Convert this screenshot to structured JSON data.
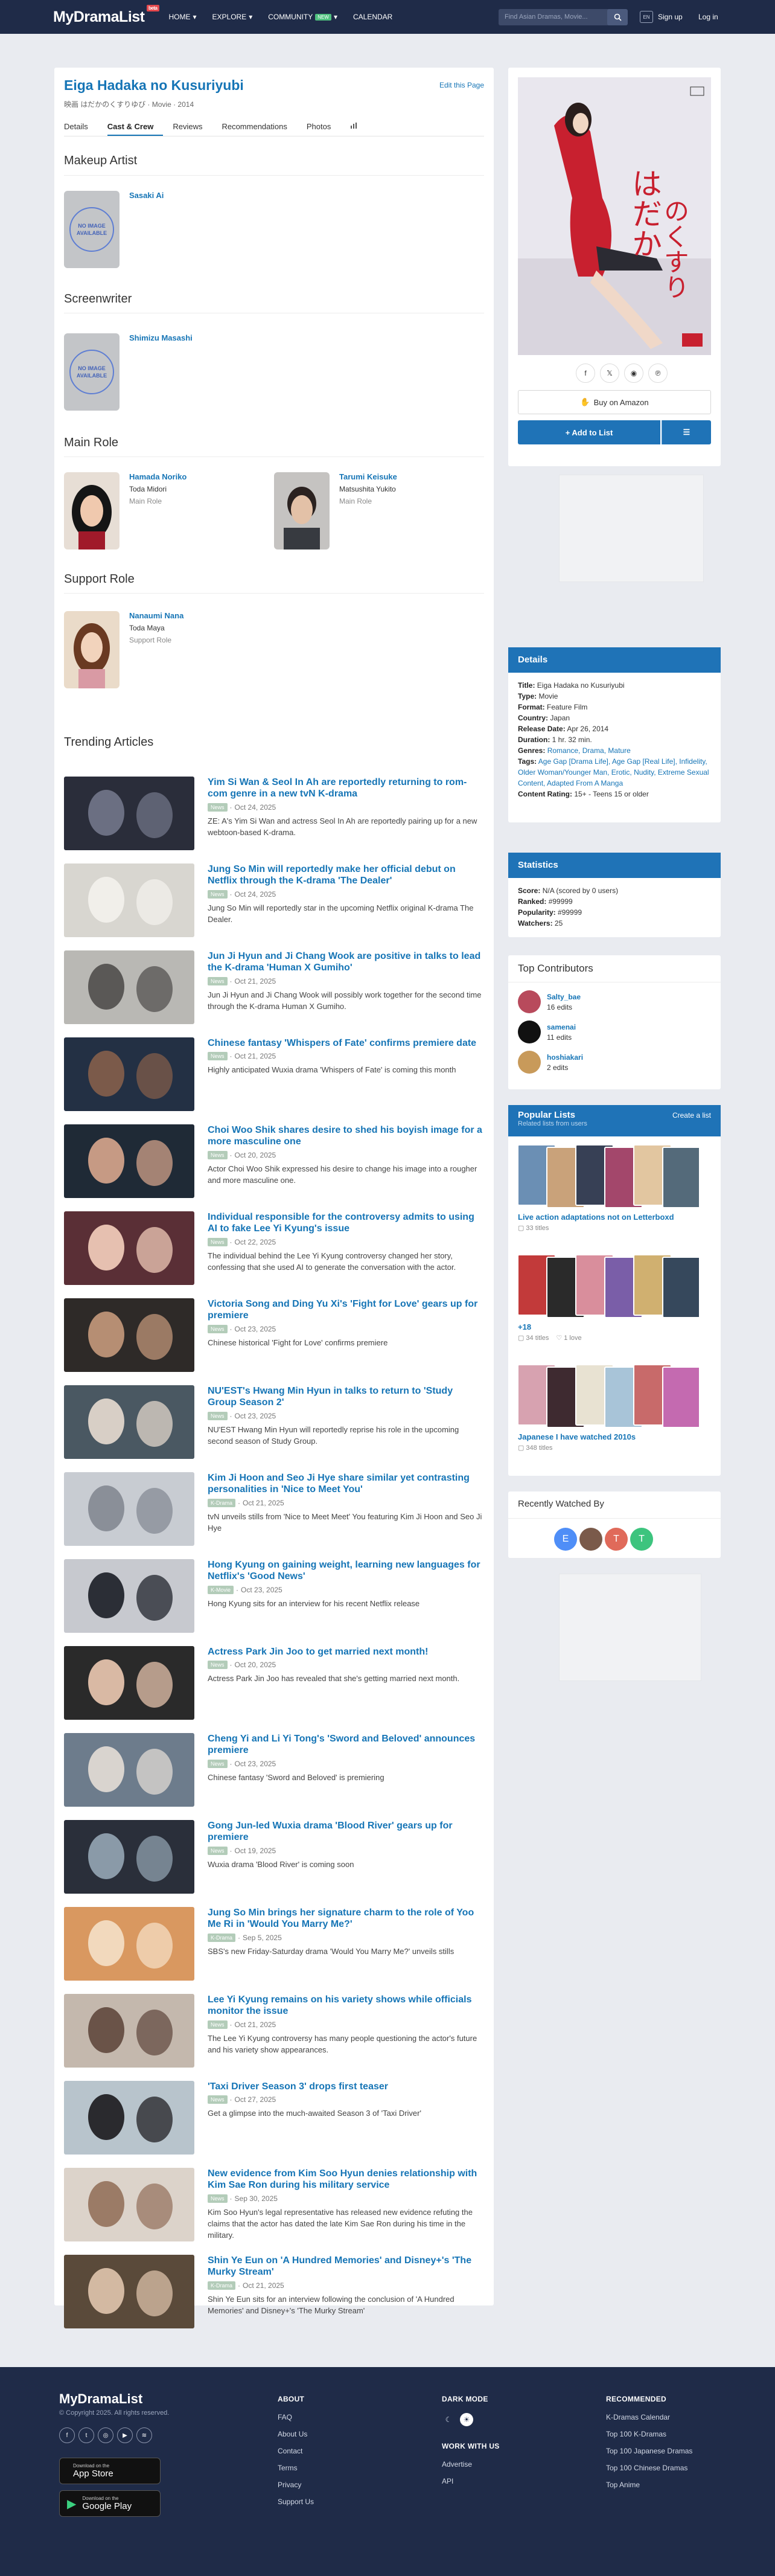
{
  "header": {
    "logo": "MyDramaList",
    "logo_badge": "beta",
    "nav": [
      "HOME",
      "EXPLORE",
      "COMMUNITY",
      "CALENDAR"
    ],
    "new_badge": "NEW",
    "search_placeholder": "Find Asian Dramas, Movie...",
    "lang": "EN",
    "signup": "Sign up",
    "login": "Log in"
  },
  "title": {
    "name": "Eiga Hadaka no Kusuriyubi",
    "native": "映画 はだかのくすりゆび · Movie · 2014",
    "edit": "Edit this Page"
  },
  "tabs": [
    "Details",
    "Cast & Crew",
    "Reviews",
    "Recommendations",
    "Photos"
  ],
  "sections": {
    "makeup": "Makeup Artist",
    "screenwriter": "Screenwriter",
    "main_role": "Main Role",
    "support_role": "Support Role",
    "trending": "Trending Articles"
  },
  "no_image": "NO IMAGE AVAILABLE",
  "crew": [
    {
      "name": "Sasaki Ai"
    },
    {
      "name": "Shimizu Masashi"
    }
  ],
  "main_cast": [
    {
      "name": "Hamada Noriko",
      "character": "Toda Midori",
      "role": "Main Role"
    },
    {
      "name": "Tarumi Keisuke",
      "character": "Matsushita Yukito",
      "role": "Main Role"
    }
  ],
  "support_cast": [
    {
      "name": "Nanaumi Nana",
      "character": "Toda Maya",
      "role": "Support Role"
    }
  ],
  "articles": [
    {
      "title": "Yim Si Wan & Seol In Ah are reportedly returning to rom-com genre in a new tvN K-drama",
      "cat": "News",
      "date": "Oct 24, 2025",
      "desc": "ZE: A's Yim Si Wan and actress Seol In Ah are reportedly pairing up for a new webtoon-based K-drama."
    },
    {
      "title": "Jung So Min will reportedly make her official debut on Netflix through the K-drama 'The Dealer'",
      "cat": "News",
      "date": "Oct 24, 2025",
      "desc": "Jung So Min will reportedly star in the upcoming Netflix original K-drama The Dealer."
    },
    {
      "title": "Jun Ji Hyun and Ji Chang Wook are positive in talks to lead the K-drama 'Human X Gumiho'",
      "cat": "News",
      "date": "Oct 21, 2025",
      "desc": "Jun Ji Hyun and Ji Chang Wook will possibly work together for the second time through the K-drama Human X Gumiho."
    },
    {
      "title": "Chinese fantasy 'Whispers of Fate' confirms premiere date",
      "cat": "News",
      "date": "Oct 21, 2025",
      "desc": "Highly anticipated Wuxia drama 'Whispers of Fate' is coming this month"
    },
    {
      "title": "Choi Woo Shik shares desire to shed his boyish image for a more masculine one",
      "cat": "News",
      "date": "Oct 20, 2025",
      "desc": "Actor Choi Woo Shik expressed his desire to change his image into a rougher and more masculine one."
    },
    {
      "title": "Individual responsible for the controversy admits to using AI to fake Lee Yi Kyung's issue",
      "cat": "News",
      "date": "Oct 22, 2025",
      "desc": "The individual behind the Lee Yi Kyung controversy changed her story, confessing that she used AI to generate the conversation with the actor."
    },
    {
      "title": "Victoria Song and Ding Yu Xi's 'Fight for Love' gears up for premiere",
      "cat": "News",
      "date": "Oct 23, 2025",
      "desc": "Chinese historical 'Fight for Love' confirms premiere"
    },
    {
      "title": "NU'EST's Hwang Min Hyun in talks to return to 'Study Group Season 2'",
      "cat": "News",
      "date": "Oct 23, 2025",
      "desc": "NU'EST Hwang Min Hyun will reportedly reprise his role in the upcoming second season of Study Group."
    },
    {
      "title": "Kim Ji Hoon and Seo Ji Hye share similar yet contrasting personalities in 'Nice to Meet You'",
      "cat": "K-Drama",
      "date": "Oct 21, 2025",
      "desc": "tvN unveils stills from 'Nice to Meet Meet' You featuring Kim Ji Hoon and Seo Ji Hye"
    },
    {
      "title": "Hong Kyung on gaining weight, learning new languages for Netflix's 'Good News'",
      "cat": "K-Movie",
      "date": "Oct 23, 2025",
      "desc": "Hong Kyung sits for an interview for his recent Netflix release"
    },
    {
      "title": "Actress Park Jin Joo to get married next month!",
      "cat": "News",
      "date": "Oct 20, 2025",
      "desc": "Actress Park Jin Joo has revealed that she's getting married next month."
    },
    {
      "title": "Cheng Yi and Li Yi Tong's 'Sword and Beloved' announces premiere",
      "cat": "News",
      "date": "Oct 23, 2025",
      "desc": "Chinese fantasy 'Sword and Beloved' is premiering"
    },
    {
      "title": "Gong Jun-led Wuxia drama 'Blood River' gears up for premiere",
      "cat": "News",
      "date": "Oct 19, 2025",
      "desc": "Wuxia drama 'Blood River' is coming soon"
    },
    {
      "title": "Jung So Min brings her signature charm to the role of Yoo Me Ri in 'Would You Marry Me?'",
      "cat": "K-Drama",
      "date": "Sep 5, 2025",
      "desc": "SBS's new Friday-Saturday drama 'Would You Marry Me?' unveils stills"
    },
    {
      "title": "Lee Yi Kyung remains on his variety shows while officials monitor the issue",
      "cat": "News",
      "date": "Oct 21, 2025",
      "desc": "The Lee Yi Kyung controversy has many people questioning the actor's future and his variety show appearances."
    },
    {
      "title": "'Taxi Driver Season 3' drops first teaser",
      "cat": "News",
      "date": "Oct 27, 2025",
      "desc": "Get a glimpse into the much-awaited Season 3 of 'Taxi Driver'"
    },
    {
      "title": "New evidence from Kim Soo Hyun denies relationship with Kim Sae Ron during his military service",
      "cat": "News",
      "date": "Sep 30, 2025",
      "desc": "Kim Soo Hyun's legal representative has released new evidence refuting the claims that the actor has dated the late Kim Sae Ron during his time in the military."
    },
    {
      "title": "Shin Ye Eun on 'A Hundred Memories' and Disney+'s 'The Murky Stream'",
      "cat": "K-Drama",
      "date": "Oct 21, 2025",
      "desc": "Shin Ye Eun sits for an interview following the conclusion of 'A Hundred Memories' and Disney+'s 'The Murky Stream'"
    }
  ],
  "sidebar": {
    "buy": "Buy on Amazon",
    "add_list": "+ Add to List",
    "details_head": "Details",
    "details": [
      {
        "k": "Title:",
        "v": "Eiga Hadaka no Kusuriyubi"
      },
      {
        "k": "Type:",
        "v": "Movie"
      },
      {
        "k": "Format:",
        "v": "Feature Film"
      },
      {
        "k": "Country:",
        "v": "Japan"
      },
      {
        "k": "Release Date:",
        "v": "Apr 26, 2014"
      },
      {
        "k": "Duration:",
        "v": "1 hr. 32 min."
      },
      {
        "k": "Genres:",
        "v": "Romance, Drama, Mature"
      }
    ],
    "tags_label": "Tags:",
    "tags": "Age Gap [Drama Life], Age Gap [Real Life], Infidelity, Older Woman/Younger Man, Erotic, Nudity, Extreme Sexual Content, Adapted From A Manga",
    "rating_label": "Content Rating:",
    "rating": "15+ - Teens 15 or older",
    "stats_head": "Statistics",
    "stats": [
      {
        "k": "Score:",
        "v": "N/A (scored by 0 users)"
      },
      {
        "k": "Ranked:",
        "v": "#99999"
      },
      {
        "k": "Popularity:",
        "v": "#99999"
      },
      {
        "k": "Watchers:",
        "v": "25"
      }
    ],
    "contrib_head": "Top Contributors",
    "contributors": [
      {
        "name": "Salty_bae",
        "edits": "16 edits"
      },
      {
        "name": "samenai",
        "edits": "11 edits"
      },
      {
        "name": "hoshiakari",
        "edits": "2 edits"
      }
    ],
    "lists_head": "Popular Lists",
    "lists_sub": "Related lists from users",
    "create_list": "Create a list",
    "lists": [
      {
        "title": "Live action adaptations not on Letterboxd",
        "likes": "33 titles"
      },
      {
        "title": "+18",
        "likes": "34 titles",
        "hearts": "1 love"
      },
      {
        "title": "Japanese I have watched 2010s",
        "likes": "348 titles"
      }
    ],
    "recent_head": "Recently Watched By",
    "recent": [
      "E",
      "",
      "T",
      "T"
    ]
  },
  "footer": {
    "logo": "MyDramaList",
    "copyright": "© Copyright 2025. All rights reserved.",
    "app_small": "Download on the",
    "app_store": "App Store",
    "play_small": "Download on the",
    "play_store": "Google Play",
    "about_head": "ABOUT",
    "about": [
      "FAQ",
      "About Us",
      "Contact",
      "Terms",
      "Privacy",
      "Support Us"
    ],
    "dark_head": "DARK MODE",
    "work_head": "WORK WITH US",
    "work": [
      "Advertise",
      "API"
    ],
    "rec_head": "RECOMMENDED",
    "rec": [
      "K-Dramas Calendar",
      "Top 100 K-Dramas",
      "Top 100 Japanese Dramas",
      "Top 100 Chinese Dramas",
      "Top Anime"
    ]
  },
  "colors": {
    "nav": "#1f2b48",
    "link": "#1675b6",
    "accent": "#1f73b7",
    "page": "#e9ebf0"
  }
}
